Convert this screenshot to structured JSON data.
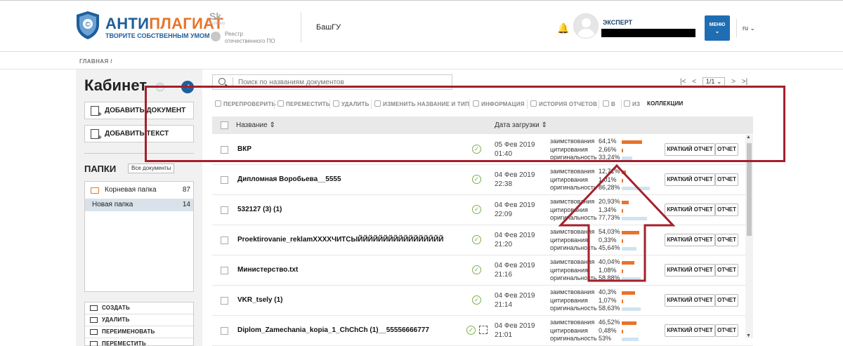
{
  "header": {
    "brand_main": "АНТИ",
    "brand_accent": "ПЛАГИАТ",
    "brand_tagline": "ТВОРИТЕ СОБСТВЕННЫМ УМОМ",
    "sk_logo": "Sk",
    "sk_sub": "Skolkovo",
    "reestr_line1": "Реестр",
    "reestr_line2": "отечественного ПО",
    "org": "БашГУ",
    "user_role": "ЭКСПЕРТ",
    "menu_label": "МЕНЮ",
    "lang": "ru ⌄"
  },
  "breadcrumb": "ГЛАВНАЯ /",
  "sidebar": {
    "title": "Кабинет",
    "add_document": "ДОБАВИТЬ ДОКУМЕНТ",
    "add_text": "ДОБАВИТЬ ТЕКСТ",
    "folders_title": "ПАПКИ",
    "all_docs": "Все документы",
    "folders": [
      {
        "name": "Корневая папка",
        "count": "87"
      },
      {
        "name": "Новая папка",
        "count": "14"
      }
    ],
    "folder_actions": [
      "СОЗДАТЬ",
      "УДАЛИТЬ",
      "ПЕРЕИМЕНОВАТЬ",
      "ПЕРЕМЕСТИТЬ"
    ]
  },
  "search": {
    "placeholder": "Поиск по названиям документов"
  },
  "pager": {
    "first": "|<",
    "prev": "<",
    "page": "1/1 ⌄",
    "next": ">",
    "last": ">|"
  },
  "toolbar": {
    "recheck": "ПЕРЕПРОВЕРИТЬ",
    "move": "ПЕРЕМЕСТИТЬ",
    "delete": "УДАЛИТЬ",
    "rename": "ИЗМЕНИТЬ НАЗВАНИЕ И ТИП",
    "info": "ИНФОРМАЦИЯ",
    "history": "ИСТОРИЯ ОТЧЕТОВ",
    "to": "В",
    "from": "ИЗ",
    "collections": "КОЛЛЕКЦИИ"
  },
  "table": {
    "col_name": "Название ⇕",
    "col_date": "Дата загрузки ⇕",
    "stat_labels": [
      "заимствования",
      "цитирования",
      "оригинальность"
    ],
    "btn_short": "КРАТКИЙ ОТЧЕТ",
    "btn_full": "ОТЧЕТ",
    "rows": [
      {
        "name": "ВКР",
        "date": "05 Фев 2019",
        "time": "01:40",
        "borrow": "64,1%",
        "cite": "2,66%",
        "orig": "33,24%",
        "borrow_frac": 0.641,
        "cite_frac": 0.0266,
        "orig_frac": 0.3324
      },
      {
        "name": "Дипломная Воробьева__5555",
        "date": "04 Фев 2019",
        "time": "22:38",
        "borrow": "12,71%",
        "cite": "1,01%",
        "orig": "86,28%",
        "borrow_frac": 0.1271,
        "cite_frac": 0.0101,
        "orig_frac": 0.8628
      },
      {
        "name": "532127 (3) (1)",
        "date": "04 Фев 2019",
        "time": "22:09",
        "borrow": "20,93%",
        "cite": "1,34%",
        "orig": "77,73%",
        "borrow_frac": 0.2093,
        "cite_frac": 0.0134,
        "orig_frac": 0.7773
      },
      {
        "name": "Proektirovanie_reklamXXXXЧИТСЫЙЙЙЙЙЙЙЙЙЙЙЙЙЙЙЙЙ",
        "date": "04 Фев 2019",
        "time": "21:20",
        "borrow": "54,03%",
        "cite": "0,33%",
        "orig": "45,64%",
        "borrow_frac": 0.5403,
        "cite_frac": 0.0033,
        "orig_frac": 0.4564
      },
      {
        "name": "Министерство.txt",
        "date": "04 Фев 2019",
        "time": "21:16",
        "borrow": "40,04%",
        "cite": "1,08%",
        "orig": "58,88%",
        "borrow_frac": 0.4004,
        "cite_frac": 0.0108,
        "orig_frac": 0.5888
      },
      {
        "name": "VKR_tsely (1)",
        "date": "04 Фев 2019",
        "time": "21:14",
        "borrow": "40,3%",
        "cite": "1,07%",
        "orig": "58,63%",
        "borrow_frac": 0.403,
        "cite_frac": 0.0107,
        "orig_frac": 0.5863
      },
      {
        "name": "Diplom_Zamechania_kopia_1_ChChCh (1)__55556666777",
        "date": "04 Фев 2019",
        "time": "21:01",
        "borrow": "46,52%",
        "cite": "0,48%",
        "orig": "53%",
        "borrow_frac": 0.4652,
        "cite_frac": 0.0048,
        "orig_frac": 0.53
      }
    ]
  },
  "colors": {
    "brand_blue": "#1f5e9a",
    "accent_orange": "#e8732a",
    "orig_bar": "#cfe3f2",
    "annotation_red": "#a4202c",
    "ok_green": "#7bb04a"
  }
}
